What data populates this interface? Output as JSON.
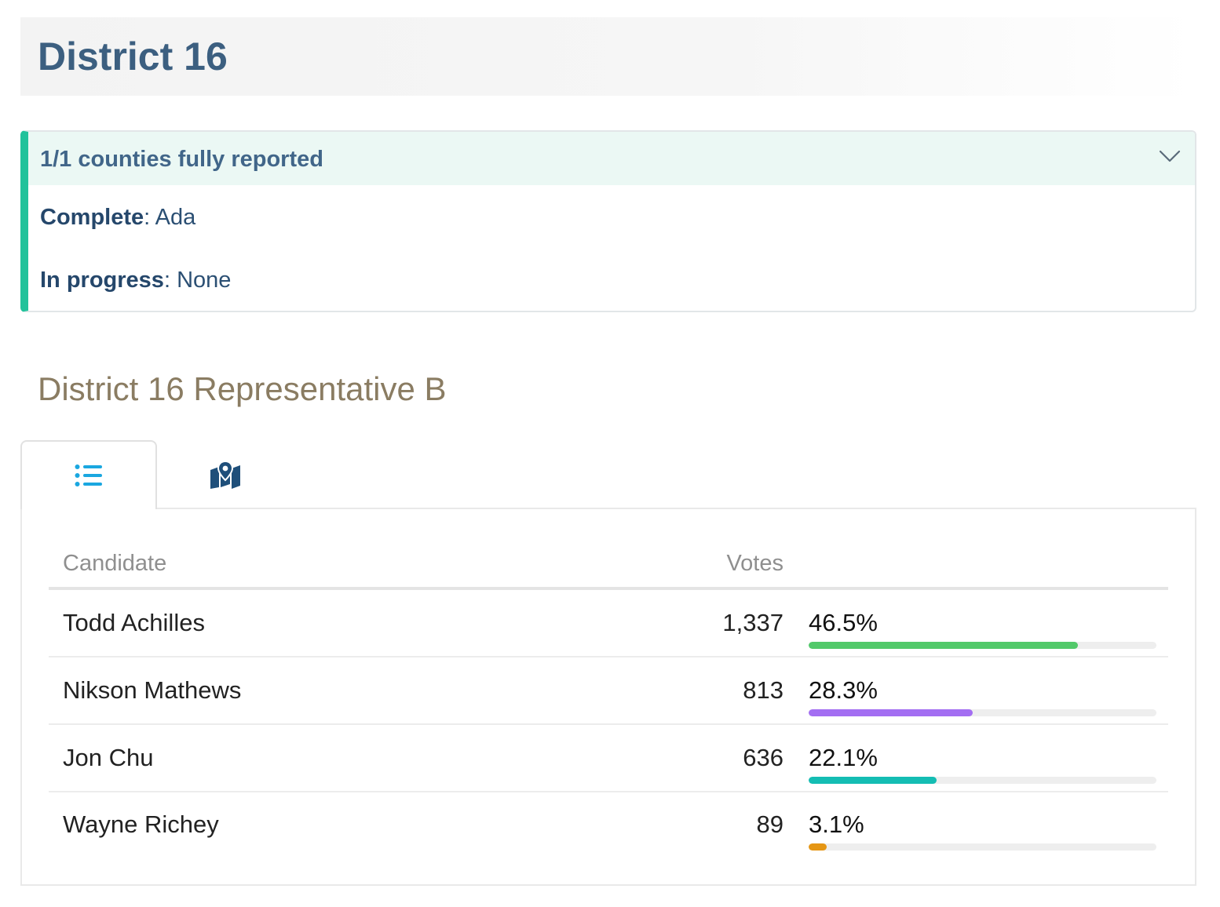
{
  "district": {
    "title": "District 16"
  },
  "reporting": {
    "summary": "1/1 counties fully reported",
    "complete_label": "Complete",
    "complete_value": "Ada",
    "in_progress_label": "In progress",
    "in_progress_value": "None",
    "accent_color": "#22c29b",
    "toggle_icon": "chevron-down-icon"
  },
  "race": {
    "title": "District 16 Representative B",
    "tabs": [
      {
        "icon": "list-icon",
        "active": true,
        "color": "#1aa7e0"
      },
      {
        "icon": "map-marker-icon",
        "active": false,
        "color": "#1f4f7a"
      }
    ],
    "columns": {
      "candidate": "Candidate",
      "votes": "Votes"
    },
    "candidates": [
      {
        "name": "Todd Achilles",
        "votes": "1,337",
        "percent": "46.5%",
        "share": 0.775,
        "color": "#52c96a"
      },
      {
        "name": "Nikson Mathews",
        "votes": "813",
        "percent": "28.3%",
        "share": 0.472,
        "color": "#a36ef2"
      },
      {
        "name": "Jon Chu",
        "votes": "636",
        "percent": "22.1%",
        "share": 0.368,
        "color": "#14bdb3"
      },
      {
        "name": "Wayne Richey",
        "votes": "89",
        "percent": "3.1%",
        "share": 0.052,
        "color": "#e59614"
      }
    ]
  }
}
